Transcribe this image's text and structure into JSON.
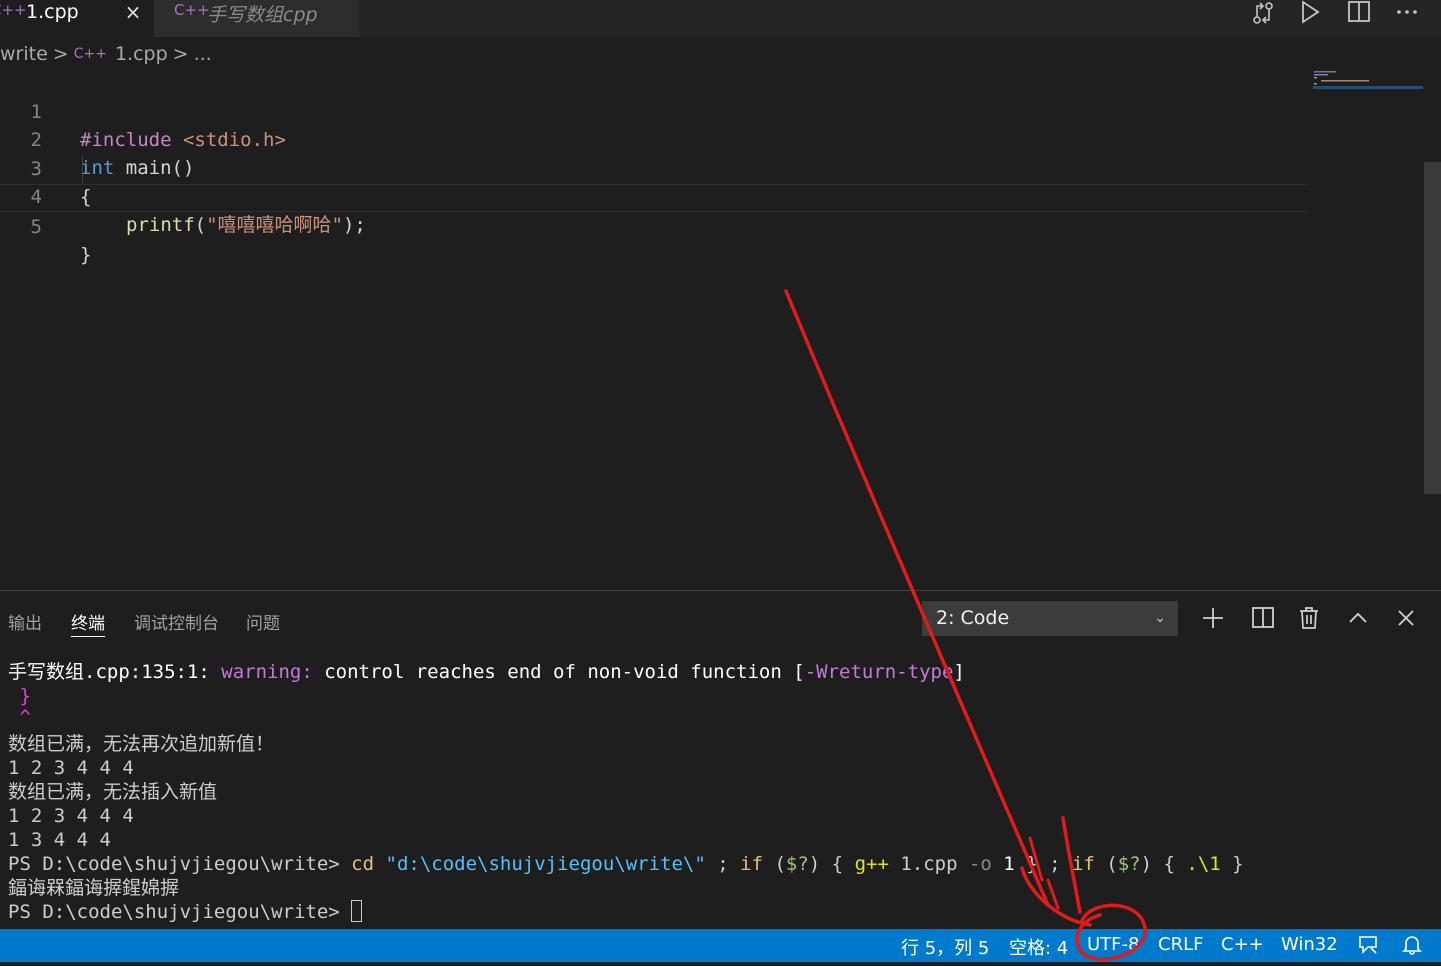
{
  "tabs": [
    {
      "label": "1.cpp",
      "active": true,
      "icon": "cpp-file-icon"
    },
    {
      "label": "手写数组cpp",
      "active": false,
      "icon": "cpp-file-icon"
    }
  ],
  "cpp_glyph": "C++",
  "close_glyph": "×",
  "breadcrumb": {
    "folder": "write",
    "file": "1.cpp",
    "more": "...",
    "sep": ">"
  },
  "editor": {
    "line_numbers": [
      "1",
      "2",
      "3",
      "4",
      "5"
    ],
    "line1": {
      "directive": "#include",
      "header": "<stdio.h>"
    },
    "line2": {
      "type": "int",
      "rest": "main()"
    },
    "line3": "{",
    "line4": {
      "fn": "printf",
      "open": "(",
      "str": "\"嘻嘻嘻哈啊哈\"",
      "close": ");"
    },
    "line5": "}"
  },
  "panel": {
    "tabs": [
      "输出",
      "终端",
      "调试控制台",
      "问题"
    ],
    "active_tab": "终端",
    "terminal_select": "2: Code",
    "chevron": "⌄"
  },
  "terminal": {
    "l1_file": "手写数组.cpp:135:1: ",
    "l1_warn": "warning:",
    "l1_msg": " control reaches end of non-void function [",
    "l1_flag": "-Wreturn-type",
    "l1_end": "]",
    "l2": " }",
    "l3": " ^",
    "l4": "数组已满，无法再次追加新值！",
    "l5": "1 2 3 4 4 4",
    "l6": "数组已满，无法插入新值",
    "l7": "1 2 3 4 4 4",
    "l8": "1 3 4 4 4",
    "l9_prompt": "PS D:\\code\\shujvjiegou\\write> ",
    "l9_cd": "cd",
    "l9_str": " \"d:\\code\\shujvjiegou\\write\\\"",
    "l9_semi": " ; ",
    "l9_if": "if",
    "l9_open": " (",
    "l9_var": "$?",
    "l9_close": ") { ",
    "l9_gpp": "g++",
    "l9_file": " 1.cpp ",
    "l9_o": "-o",
    "l9_one": " 1",
    "l9_mid": " } ; ",
    "l9_if2": "if",
    "l9_open2": " (",
    "l9_var2": "$?",
    "l9_close2": ") { ",
    "l9_run": ".\\1",
    "l9_end": " }",
    "l10": "鍢诲槑鍢诲搱鍟婂搱",
    "l11_prompt": "PS D:\\code\\shujvjiegou\\write> "
  },
  "statusbar": {
    "position": "行 5，列 5",
    "spaces": "空格: 4",
    "encoding": "UTF-8",
    "eol": "CRLF",
    "language": "C++",
    "platform": "Win32"
  },
  "colors": {
    "accent": "#007acc",
    "annotation": "#e01b1b"
  }
}
